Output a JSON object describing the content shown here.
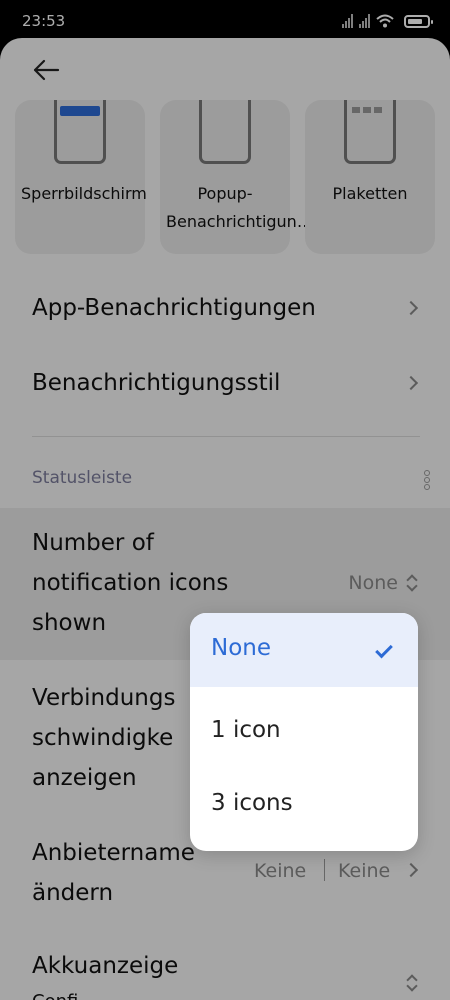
{
  "status_bar": {
    "time": "23:53",
    "battery_level": 0.75
  },
  "cards": [
    {
      "label": "Sperrbildschirm"
    },
    {
      "label": "Popup-Benachrichtigun…"
    },
    {
      "label": "Plaketten"
    }
  ],
  "rows": {
    "app_notifications": "App-Benachrichtigungen",
    "notification_style": "Benachrichtigungsstil"
  },
  "section": {
    "title": "Statusleiste"
  },
  "icons_setting": {
    "title_lines": [
      "Number of",
      "notification icons",
      "shown"
    ],
    "value": "None"
  },
  "speed_setting": {
    "title_lines": [
      "Verbindungs",
      "schwindigke",
      "anzeigen"
    ]
  },
  "carrier_setting": {
    "title_lines": [
      "Anbietername",
      "ändern"
    ],
    "value_sim1": "Keine",
    "value_sim2": "Keine"
  },
  "battery_setting": {
    "title_lines": [
      "Akkuanzeige",
      "Confi…"
    ]
  },
  "popup": {
    "options": [
      "None",
      "1 icon",
      "3 icons"
    ],
    "selected": "None"
  },
  "colors": {
    "accent": "#2d6bd5",
    "section_title": "#7b7b9a"
  }
}
